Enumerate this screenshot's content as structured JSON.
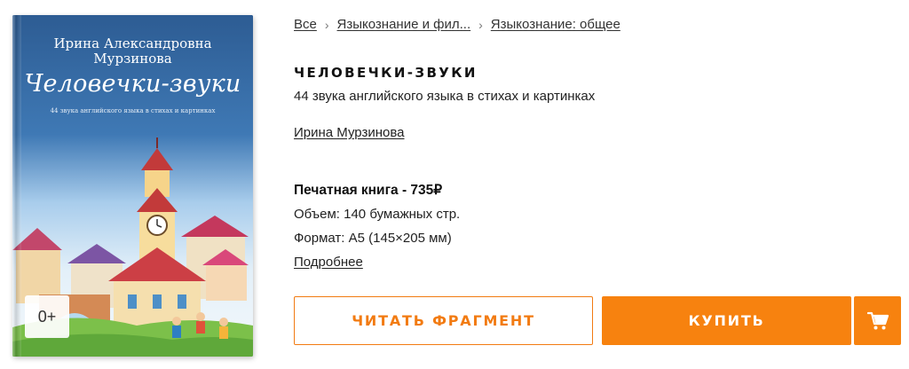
{
  "breadcrumb": {
    "items": [
      "Все",
      "Языкознание и фил...",
      "Языкознание: общее"
    ],
    "separator": "›"
  },
  "cover": {
    "author": "Ирина Александровна Мурзинова",
    "title": "Человечки-звуки",
    "subtitle": "44 звука английского языка в стихах и картинках",
    "age_rating": "0+",
    "colors": {
      "sky": "#2e5f96",
      "accent": "#f7820f"
    }
  },
  "book": {
    "title": "ЧЕЛОВЕЧКИ-ЗВУКИ",
    "subtitle": "44 звука английского языка в стихах и картинках",
    "author": "Ирина Мурзинова"
  },
  "details": {
    "price_line": "Печатная книга - 735₽",
    "volume": "Объем: 140 бумажных стр.",
    "format": "Формат: A5 (145×205 мм)",
    "more_link": "Подробнее"
  },
  "actions": {
    "read_fragment": "ЧИТАТЬ ФРАГМЕНТ",
    "buy": "КУПИТЬ",
    "cart_icon": "cart-icon"
  },
  "colors": {
    "accent": "#f7820f",
    "text": "#222222"
  }
}
